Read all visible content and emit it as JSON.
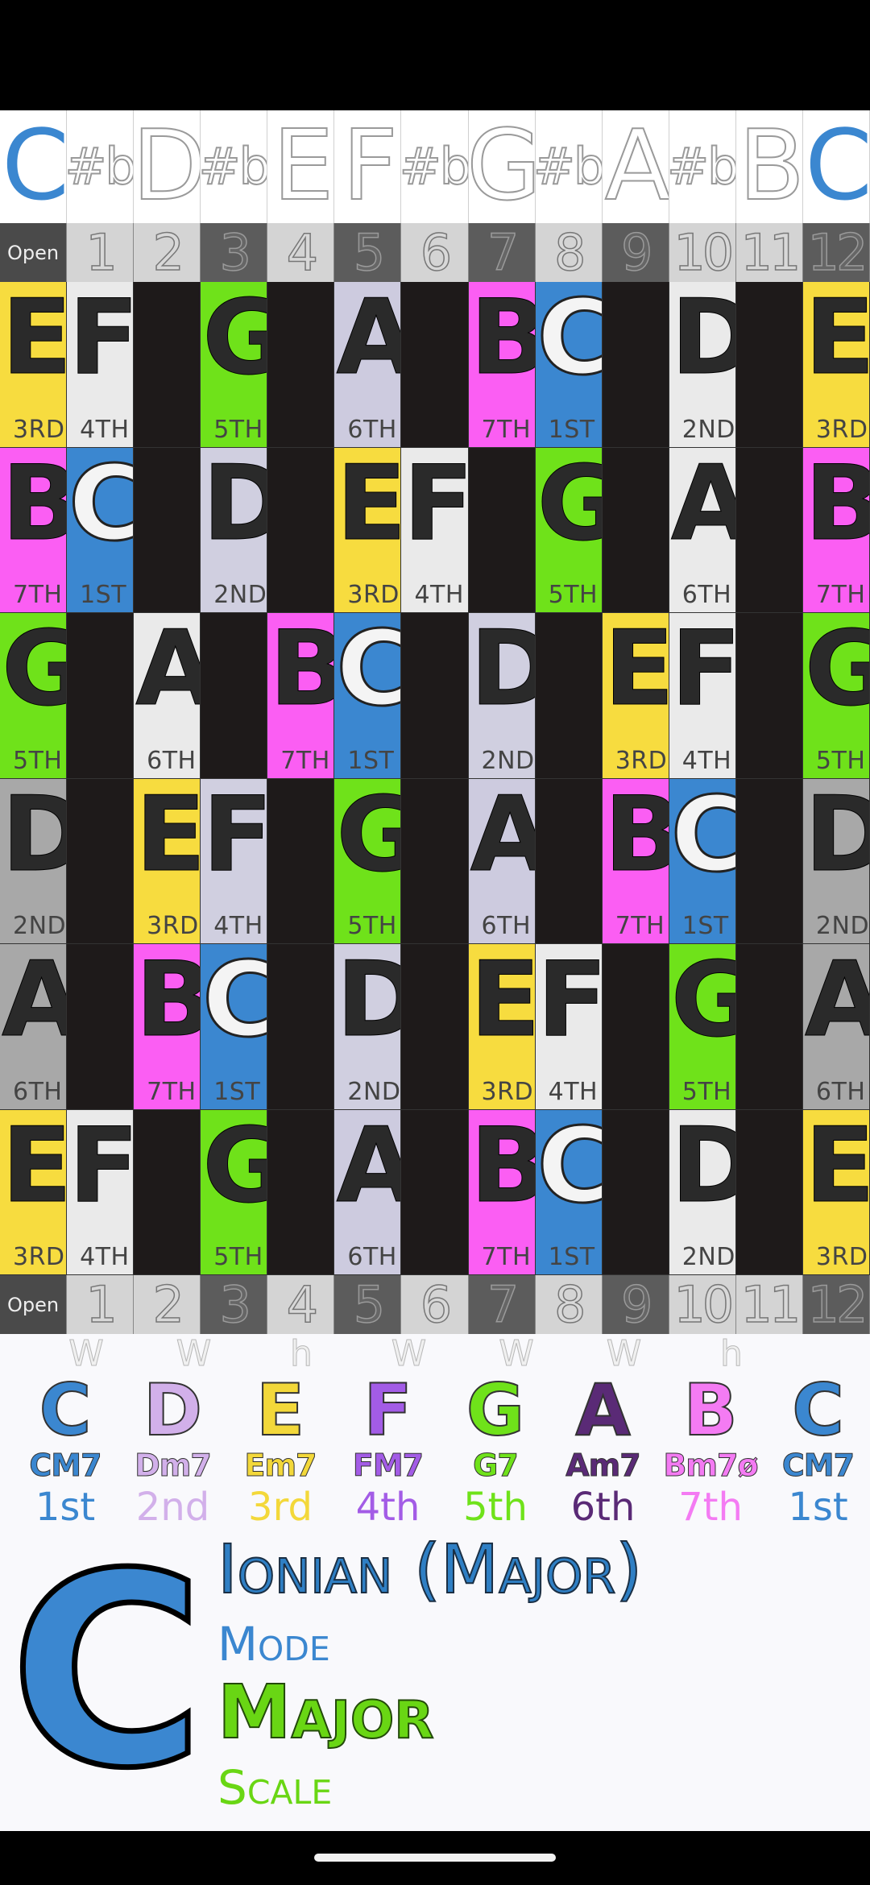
{
  "keys": [
    {
      "label": "C",
      "sharp": false,
      "active": true
    },
    {
      "label": "#b",
      "sharp": true,
      "active": false
    },
    {
      "label": "D",
      "sharp": false,
      "active": false
    },
    {
      "label": "#b",
      "sharp": true,
      "active": false
    },
    {
      "label": "E",
      "sharp": false,
      "active": false
    },
    {
      "label": "F",
      "sharp": false,
      "active": false
    },
    {
      "label": "#b",
      "sharp": true,
      "active": false
    },
    {
      "label": "G",
      "sharp": false,
      "active": false
    },
    {
      "label": "#b",
      "sharp": true,
      "active": false
    },
    {
      "label": "A",
      "sharp": false,
      "active": false
    },
    {
      "label": "#b",
      "sharp": true,
      "active": false
    },
    {
      "label": "B",
      "sharp": false,
      "active": false
    },
    {
      "label": "C",
      "sharp": false,
      "active": true
    }
  ],
  "frets": [
    "Open",
    "1",
    "2",
    "3",
    "4",
    "5",
    "6",
    "7",
    "8",
    "9",
    "10",
    "11",
    "12"
  ],
  "colors": {
    "C": "#3b87d0",
    "D": "#d0cfe0",
    "E": "#f7dc3f",
    "F": "#eaeaea",
    "G": "#6fe21a",
    "A": "#cdcbdf",
    "B": "#fb5ef3",
    "empty": "#1e1a1a",
    "open_D": "#a8a8a8",
    "open_A": "#a8a8a8",
    "F_alt": "#d0cfe0",
    "D_alt": "#eaeaea"
  },
  "fretboard": [
    [
      {
        "n": "E",
        "d": "3RD"
      },
      {
        "n": "F",
        "d": "4TH"
      },
      null,
      {
        "n": "G",
        "d": "5TH"
      },
      null,
      {
        "n": "A",
        "d": "6TH"
      },
      null,
      {
        "n": "B",
        "d": "7TH"
      },
      {
        "n": "C",
        "d": "1ST"
      },
      null,
      {
        "n": "D",
        "d": "2ND",
        "alt": true
      },
      null,
      {
        "n": "E",
        "d": "3RD"
      }
    ],
    [
      {
        "n": "B",
        "d": "7TH"
      },
      {
        "n": "C",
        "d": "1ST"
      },
      null,
      {
        "n": "D",
        "d": "2ND"
      },
      null,
      {
        "n": "E",
        "d": "3RD"
      },
      {
        "n": "F",
        "d": "4TH"
      },
      null,
      {
        "n": "G",
        "d": "5TH"
      },
      null,
      {
        "n": "A",
        "d": "6TH",
        "light": true
      },
      null,
      {
        "n": "B",
        "d": "7TH"
      }
    ],
    [
      {
        "n": "G",
        "d": "5TH"
      },
      null,
      {
        "n": "A",
        "d": "6TH",
        "light": true
      },
      null,
      {
        "n": "B",
        "d": "7TH"
      },
      {
        "n": "C",
        "d": "1ST"
      },
      null,
      {
        "n": "D",
        "d": "2ND"
      },
      null,
      {
        "n": "E",
        "d": "3RD"
      },
      {
        "n": "F",
        "d": "4TH"
      },
      null,
      {
        "n": "G",
        "d": "5TH"
      }
    ],
    [
      {
        "n": "D",
        "d": "2ND",
        "open": true
      },
      null,
      {
        "n": "E",
        "d": "3RD"
      },
      {
        "n": "F",
        "d": "4TH",
        "alt": true
      },
      null,
      {
        "n": "G",
        "d": "5TH"
      },
      null,
      {
        "n": "A",
        "d": "6TH"
      },
      null,
      {
        "n": "B",
        "d": "7TH"
      },
      {
        "n": "C",
        "d": "1ST"
      },
      null,
      {
        "n": "D",
        "d": "2ND",
        "open": true
      }
    ],
    [
      {
        "n": "A",
        "d": "6TH",
        "open": true
      },
      null,
      {
        "n": "B",
        "d": "7TH"
      },
      {
        "n": "C",
        "d": "1ST"
      },
      null,
      {
        "n": "D",
        "d": "2ND"
      },
      null,
      {
        "n": "E",
        "d": "3RD"
      },
      {
        "n": "F",
        "d": "4TH"
      },
      null,
      {
        "n": "G",
        "d": "5TH"
      },
      null,
      {
        "n": "A",
        "d": "6TH",
        "open": true
      }
    ],
    [
      {
        "n": "E",
        "d": "3RD"
      },
      {
        "n": "F",
        "d": "4TH"
      },
      null,
      {
        "n": "G",
        "d": "5TH"
      },
      null,
      {
        "n": "A",
        "d": "6TH"
      },
      null,
      {
        "n": "B",
        "d": "7TH"
      },
      {
        "n": "C",
        "d": "1ST"
      },
      null,
      {
        "n": "D",
        "d": "2ND",
        "alt": true
      },
      null,
      {
        "n": "E",
        "d": "3RD"
      }
    ]
  ],
  "steps": [
    "W",
    "W",
    "h",
    "W",
    "W",
    "W",
    "h"
  ],
  "scale": [
    {
      "note": "C",
      "chord": "CM7",
      "degree": "1st",
      "color": "#3b87d0"
    },
    {
      "note": "D",
      "chord": "Dm7",
      "degree": "2nd",
      "color": "#d2b0ea"
    },
    {
      "note": "E",
      "chord": "Em7",
      "degree": "3rd",
      "color": "#f3d83a"
    },
    {
      "note": "F",
      "chord": "FM7",
      "degree": "4th",
      "color": "#a35ce6"
    },
    {
      "note": "G",
      "chord": "G7",
      "degree": "5th",
      "color": "#6fe21a"
    },
    {
      "note": "A",
      "chord": "Am7",
      "degree": "6th",
      "color": "#5a2a76"
    },
    {
      "note": "B",
      "chord": "Bm7ø",
      "degree": "7th",
      "color": "#f47bf3"
    },
    {
      "note": "C",
      "chord": "CM7",
      "degree": "1st",
      "color": "#3b87d0"
    }
  ],
  "summary": {
    "key": "C",
    "mode_title": "Ionian (Major)",
    "mode_word": "Mode",
    "scale_title": "Major",
    "scale_word": "Scale"
  }
}
